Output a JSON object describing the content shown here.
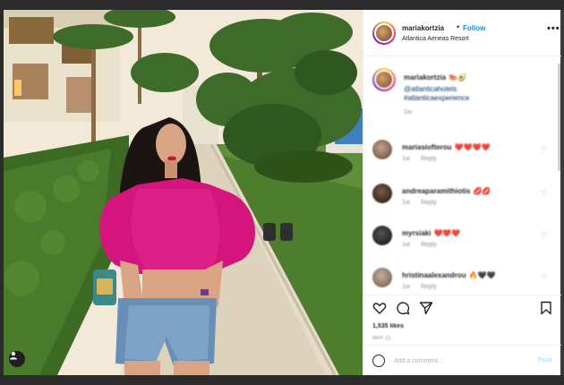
{
  "post": {
    "username": "mariakortzia",
    "follow_label": "Follow",
    "location": "Atlantica Aeneas Resort",
    "more_label": "•••"
  },
  "caption": {
    "username": "mariakortzia",
    "emoji": "🍉🥑",
    "tags": [
      "@atlanticahotels",
      "#atlanticaexperience"
    ],
    "time": "1w"
  },
  "comments": [
    {
      "username": "mariasiofterou",
      "text": "❤️❤️❤️❤️",
      "time": "1w",
      "reply_label": "Reply"
    },
    {
      "username": "andreaparamithiotis",
      "text": "💋💋",
      "time": "1w",
      "reply_label": "Reply"
    },
    {
      "username": "myrsiaki",
      "text": "❤️❤️❤️",
      "time": "1w",
      "reply_label": "Reply"
    },
    {
      "username": "hristinaalexandrou",
      "text": "🔥🖤🖤",
      "time": "1w",
      "reply_label": "Reply"
    }
  ],
  "engagement": {
    "likes": "1,535 likes",
    "date": "MAY 21"
  },
  "add_comment": {
    "placeholder": "Add a comment...",
    "post_label": "Post"
  },
  "icons": [
    "like-icon",
    "comment-icon",
    "share-icon",
    "save-icon",
    "emoji-icon",
    "user-tag-icon",
    "more-icon"
  ]
}
